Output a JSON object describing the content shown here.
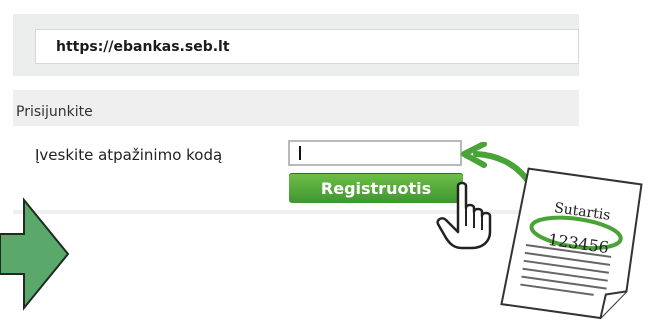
{
  "browser": {
    "url": "https://ebankas.seb.lt"
  },
  "login": {
    "title": "Prisijunkite",
    "code_label": "Įveskite atpažinimo kodą",
    "code_value": "",
    "register_label": "Registruotis"
  },
  "document": {
    "title": "Sutartis",
    "number": "123456"
  },
  "colors": {
    "accent_green": "#4aa336",
    "arrow_green": "#5aa86a",
    "panel_gray": "#eeefee"
  },
  "icons": [
    "green-arrow-icon",
    "hand-pointer-icon",
    "curved-arrow-icon",
    "contract-document-icon"
  ]
}
